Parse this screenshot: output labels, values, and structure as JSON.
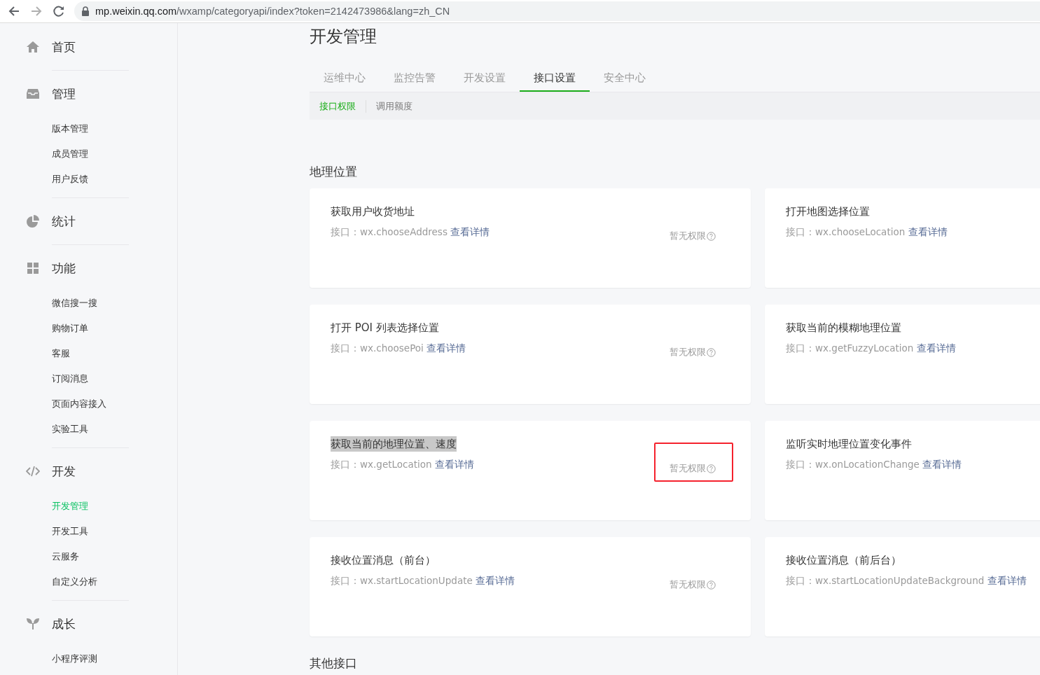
{
  "browser": {
    "url_host": "mp.weixin.qq.com",
    "url_path": "/wxamp/categoryapi/index?token=2142473986&lang=zh_CN"
  },
  "sidebar": {
    "sections": [
      {
        "title": "首页"
      },
      {
        "title": "管理",
        "items": [
          {
            "label": "版本管理",
            "selected": false
          },
          {
            "label": "成员管理",
            "selected": false
          },
          {
            "label": "用户反馈",
            "selected": false
          }
        ]
      },
      {
        "title": "统计"
      },
      {
        "title": "功能",
        "items": [
          {
            "label": "微信搜一搜",
            "selected": false
          },
          {
            "label": "购物订单",
            "selected": false
          },
          {
            "label": "客服",
            "selected": false
          },
          {
            "label": "订阅消息",
            "selected": false
          },
          {
            "label": "页面内容接入",
            "selected": false
          },
          {
            "label": "实验工具",
            "selected": false
          }
        ]
      },
      {
        "title": "开发",
        "items": [
          {
            "label": "开发管理",
            "selected": true
          },
          {
            "label": "开发工具",
            "selected": false
          },
          {
            "label": "云服务",
            "selected": false
          },
          {
            "label": "自定义分析",
            "selected": false
          }
        ]
      },
      {
        "title": "成长",
        "items": [
          {
            "label": "小程序评测",
            "selected": false
          }
        ]
      }
    ]
  },
  "page": {
    "title": "开发管理",
    "tabs": [
      {
        "label": "运维中心",
        "selected": false
      },
      {
        "label": "监控告警",
        "selected": false
      },
      {
        "label": "开发设置",
        "selected": false
      },
      {
        "label": "接口设置",
        "selected": true
      },
      {
        "label": "安全中心",
        "selected": false
      }
    ],
    "subtabs": [
      {
        "label": "接口权限",
        "selected": true
      },
      {
        "label": "调用额度",
        "selected": false
      }
    ],
    "section": "地理位置",
    "cards": [
      {
        "title": "获取用户收货地址",
        "api_label": "接口：",
        "api": "wx.chooseAddress",
        "link": "查看详情",
        "permission": "暂无权限",
        "highlighted": false
      },
      {
        "title": "打开地图选择位置",
        "api_label": "接口：",
        "api": "wx.chooseLocation",
        "link": "查看详情",
        "highlighted": false
      },
      {
        "title": "打开 POI 列表选择位置",
        "api_label": "接口：",
        "api": "wx.choosePoi",
        "link": "查看详情",
        "permission": "暂无权限",
        "highlighted": false
      },
      {
        "title": "获取当前的模糊地理位置",
        "api_label": "接口：",
        "api": "wx.getFuzzyLocation",
        "link": "查看详情",
        "highlighted": false
      },
      {
        "title": "获取当前的地理位置、速度",
        "api_label": "接口：",
        "api": "wx.getLocation",
        "link": "查看详情",
        "permission": "暂无权限",
        "highlighted": true,
        "marked": true
      },
      {
        "title": "监听实时地理位置变化事件",
        "api_label": "接口：",
        "api": "wx.onLocationChange",
        "link": "查看详情",
        "highlighted": false
      },
      {
        "title": "接收位置消息（前台）",
        "api_label": "接口：",
        "api": "wx.startLocationUpdate",
        "link": "查看详情",
        "permission": "暂无权限",
        "highlighted": false
      },
      {
        "title": "接收位置消息（前后台）",
        "api_label": "接口：",
        "api": "wx.startLocationUpdateBackground",
        "link": "查看详情",
        "highlighted": false
      }
    ],
    "next_section": "其他接口"
  }
}
